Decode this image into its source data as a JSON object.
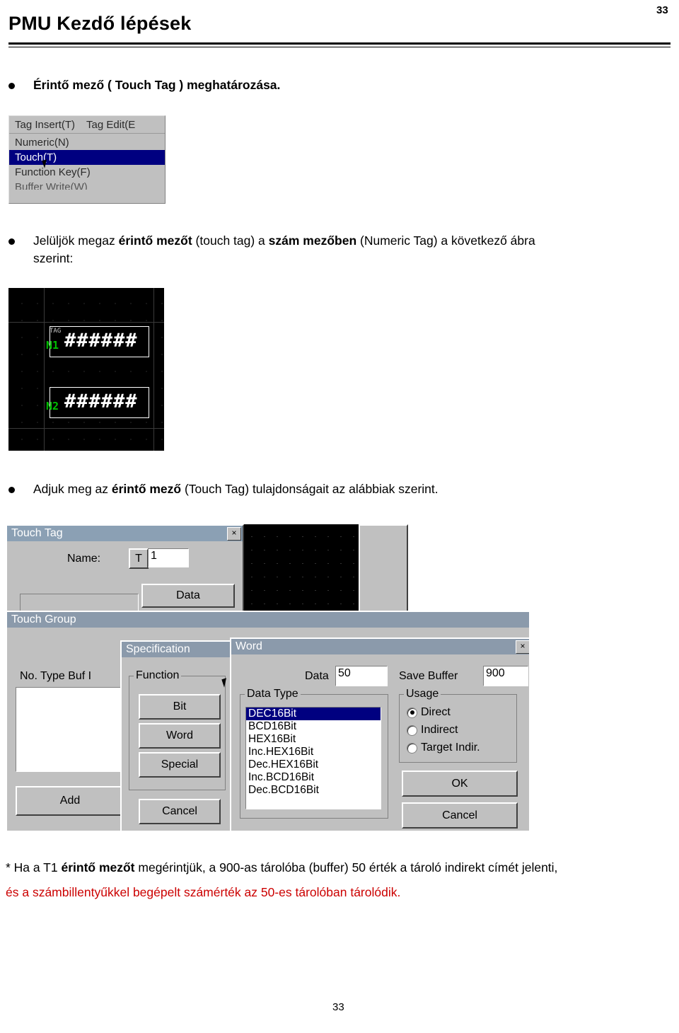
{
  "header": {
    "page_number_top": "33",
    "title": "PMU Kezdő lépések"
  },
  "bullets": {
    "b1": "Érintő mező ( Touch Tag ) meghatározása.",
    "b2_line1_a": "Jelüljök megaz ",
    "b2_bold1": "érintő mezőt",
    "b2_line1_b": " (touch tag) a ",
    "b2_bold2": "szám mezőben",
    "b2_line1_c": " (Numeric Tag) a következő ábra",
    "b2_line2": "szerint:",
    "b3_a": "Adjuk meg az ",
    "b3_bold": "érintő mező",
    "b3_b": " (Touch Tag) tulajdonságait az alábbiak szerint."
  },
  "menu_screenshot": {
    "menubar": [
      "Tag Insert(T)",
      "Tag Edit(E"
    ],
    "items": [
      {
        "label": "Numeric(N)",
        "selected": false
      },
      {
        "label": "Touch(T)",
        "selected": true
      },
      {
        "label": "Function Key(F)",
        "selected": false
      },
      {
        "label": "Buffer Write(W)",
        "selected": false
      }
    ]
  },
  "pmu_screenshot": {
    "tag1_label": "N1",
    "tag1_value": "######",
    "tag1_mini": "TAG",
    "tag2_label": "N2",
    "tag2_value": "######"
  },
  "touch_tag_dialog": {
    "title": "Touch Tag",
    "close": "×",
    "name_label": "Name:",
    "name_prefix": "T",
    "name_value": "1",
    "data_button": "Data"
  },
  "touch_group_dialog": {
    "title": "Touch Group",
    "columns": "No.  Type  Buf  I",
    "add_button": "Add"
  },
  "specification_dialog": {
    "title": "Specification",
    "function_group": "Function",
    "bit_button": "Bit",
    "word_button": "Word",
    "special_button": "Special",
    "cancel_button": "Cancel"
  },
  "word_dialog": {
    "title": "Word",
    "close": "×",
    "data_label": "Data",
    "data_value": "50",
    "save_buffer_label": "Save Buffer",
    "save_buffer_value": "900",
    "data_type_group": "Data Type",
    "data_types": [
      {
        "label": "DEC16Bit",
        "selected": true
      },
      {
        "label": "BCD16Bit",
        "selected": false
      },
      {
        "label": "HEX16Bit",
        "selected": false
      },
      {
        "label": "Inc.HEX16Bit",
        "selected": false
      },
      {
        "label": "Dec.HEX16Bit",
        "selected": false
      },
      {
        "label": "Inc.BCD16Bit",
        "selected": false
      },
      {
        "label": "Dec.BCD16Bit",
        "selected": false
      }
    ],
    "usage_group": "Usage",
    "usage_options": [
      {
        "label": "Direct",
        "selected": true
      },
      {
        "label": "Indirect",
        "selected": false
      },
      {
        "label": "Target Indir.",
        "selected": false
      }
    ],
    "ok_button": "OK",
    "cancel_button": "Cancel"
  },
  "footer": {
    "note_line1_a": "* Ha a T1 ",
    "note_line1_bold": "érintő mezőt",
    "note_line1_b": " megérintjük, a 900-as tárolóba (buffer) 50 érték a tároló indirekt címét jelenti,",
    "note_line2": "és a számbillentyűkkel begépelt számérték az 50-es tárolóban tárolódik.",
    "page_number_bottom": "33"
  }
}
